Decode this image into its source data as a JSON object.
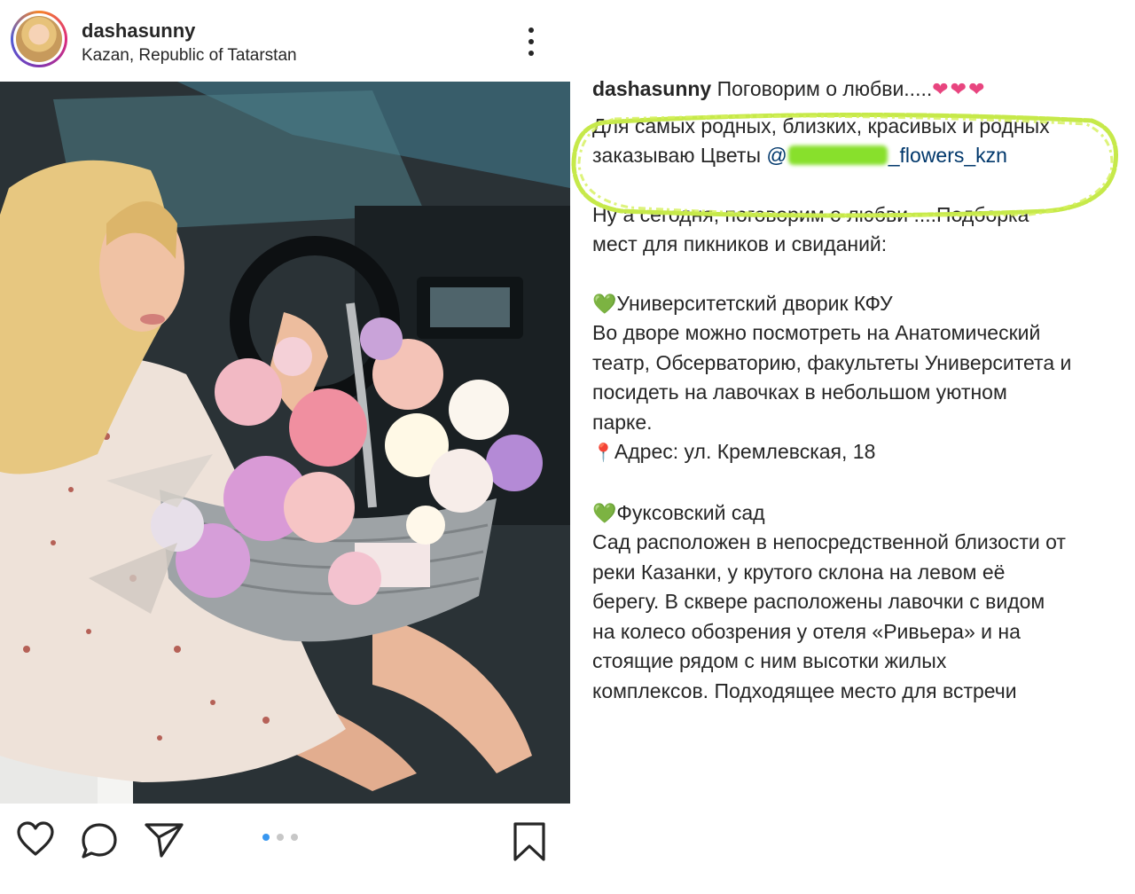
{
  "post": {
    "username": "dashasunny",
    "location": "Kazan, Republic of Tatarstan"
  },
  "actions": {
    "like_icon": "heart-outline-icon",
    "comment_icon": "comment-icon",
    "share_icon": "paper-plane-icon",
    "save_icon": "bookmark-icon"
  },
  "carousel": {
    "total": 3,
    "active": 1
  },
  "caption": {
    "username": "dashasunny",
    "title": "Поговорим о любви.....",
    "title_hearts": "❤❤❤",
    "highlight_line1": "Для самых родных, близких, красивых и родных",
    "highlight_line2_prefix": "заказываю Цветы ",
    "mention_prefix": "@",
    "mention_suffix": "_flowers_kzn",
    "intro_line1": "Ну а сегодня, поговорим о любви ....Подборка",
    "intro_line2": "мест для пикников и свиданий:",
    "place1_heart": "💚",
    "place1_name": "Университетский дворик КФУ",
    "place1_line1": "Во дворе можно посмотреть на Анатомический",
    "place1_line2": "театр, Обсерваторию, факультеты Университета и",
    "place1_line3": "посидеть на лавочках в небольшом уютном",
    "place1_line4": "парке.",
    "place1_pin": "📍",
    "place1_address": "Адрес: ул. Кремлевская, 18",
    "place2_heart": "💚",
    "place2_name": "Фуксовский сад",
    "place2_line1": "Сад расположен в непосредственной близости от",
    "place2_line2": "реки Казанки, у крутого склона на левом её",
    "place2_line3": "берегу. В сквере расположены лавочки с видом",
    "place2_line4": "на колесо обозрения у отеля «Ривьера» и на",
    "place2_line5": "стоящие рядом с ним высотки жилых",
    "place2_line6": "комплексов. Подходящее место для встречи"
  },
  "colors": {
    "text": "#262626",
    "mention": "#00376b",
    "highlight_marker": "#c6e94a",
    "heart_pink": "#e8457f",
    "heart_green": "#8cc63f",
    "carousel_active": "#3897f0"
  }
}
